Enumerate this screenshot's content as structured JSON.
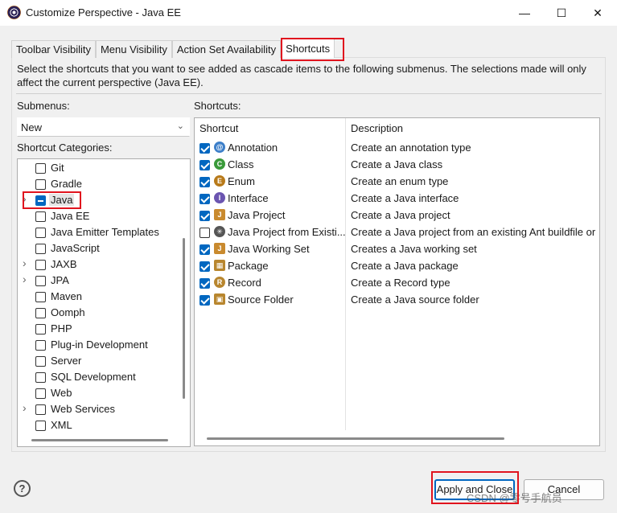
{
  "window": {
    "title": "Customize Perspective - Java EE",
    "minimize": "—",
    "maximize": "☐",
    "close": "✕"
  },
  "tabs": [
    {
      "label": "Toolbar Visibility"
    },
    {
      "label": "Menu Visibility"
    },
    {
      "label": "Action Set Availability"
    },
    {
      "label": "Shortcuts"
    }
  ],
  "description": "Select the shortcuts that you want to see added as cascade items to the following submenus. The selections made will only affect the current perspective (Java EE).",
  "submenus": {
    "label": "Submenus:",
    "value": "New"
  },
  "categories": {
    "label": "Shortcut Categories:",
    "items": [
      {
        "label": "Git",
        "expandable": false,
        "state": "unchecked"
      },
      {
        "label": "Gradle",
        "expandable": false,
        "state": "unchecked"
      },
      {
        "label": "Java",
        "expandable": true,
        "state": "partial"
      },
      {
        "label": "Java EE",
        "expandable": false,
        "state": "unchecked"
      },
      {
        "label": "Java Emitter Templates",
        "expandable": false,
        "state": "unchecked"
      },
      {
        "label": "JavaScript",
        "expandable": false,
        "state": "unchecked"
      },
      {
        "label": "JAXB",
        "expandable": true,
        "state": "unchecked"
      },
      {
        "label": "JPA",
        "expandable": true,
        "state": "unchecked"
      },
      {
        "label": "Maven",
        "expandable": false,
        "state": "unchecked"
      },
      {
        "label": "Oomph",
        "expandable": false,
        "state": "unchecked"
      },
      {
        "label": "PHP",
        "expandable": false,
        "state": "unchecked"
      },
      {
        "label": "Plug-in Development",
        "expandable": false,
        "state": "unchecked"
      },
      {
        "label": "Server",
        "expandable": false,
        "state": "unchecked"
      },
      {
        "label": "SQL Development",
        "expandable": false,
        "state": "unchecked"
      },
      {
        "label": "Web",
        "expandable": false,
        "state": "unchecked"
      },
      {
        "label": "Web Services",
        "expandable": true,
        "state": "unchecked"
      },
      {
        "label": "XML",
        "expandable": false,
        "state": "unchecked"
      }
    ]
  },
  "shortcuts": {
    "label": "Shortcuts:",
    "col_shortcut": "Shortcut",
    "col_description": "Description",
    "rows": [
      {
        "name": "Annotation",
        "desc": "Create an annotation type",
        "checked": true,
        "icon": "annotation-icon",
        "glyph": "@",
        "color": "#3d7fc9"
      },
      {
        "name": "Class",
        "desc": "Create a Java class",
        "checked": true,
        "icon": "class-icon",
        "glyph": "C",
        "color": "#3a9a3a"
      },
      {
        "name": "Enum",
        "desc": "Create an enum type",
        "checked": true,
        "icon": "enum-icon",
        "glyph": "E",
        "color": "#b87a1a"
      },
      {
        "name": "Interface",
        "desc": "Create a Java interface",
        "checked": true,
        "icon": "interface-icon",
        "glyph": "I",
        "color": "#6b55b0"
      },
      {
        "name": "Java Project",
        "desc": "Create a Java project",
        "checked": true,
        "icon": "java-project-icon",
        "glyph": "J",
        "color": "#c98a2e"
      },
      {
        "name": "Java Project from Existi...",
        "desc": "Create a Java project from an existing Ant buildfile or",
        "checked": false,
        "icon": "ant-icon",
        "glyph": "✳",
        "color": "#555555"
      },
      {
        "name": "Java Working Set",
        "desc": "Creates a Java working set",
        "checked": true,
        "icon": "working-set-icon",
        "glyph": "J",
        "color": "#c98a2e"
      },
      {
        "name": "Package",
        "desc": "Create a Java package",
        "checked": true,
        "icon": "package-icon",
        "glyph": "▦",
        "color": "#b8862e"
      },
      {
        "name": "Record",
        "desc": "Create a Record type",
        "checked": true,
        "icon": "record-icon",
        "glyph": "R",
        "color": "#b8862e"
      },
      {
        "name": "Source Folder",
        "desc": "Create a Java source folder",
        "checked": true,
        "icon": "source-folder-icon",
        "glyph": "▣",
        "color": "#b8862e"
      }
    ]
  },
  "buttons": {
    "help": "?",
    "apply_close": "Apply and Close",
    "cancel": "Cancel"
  },
  "watermark": "CSDN @零号手航员"
}
